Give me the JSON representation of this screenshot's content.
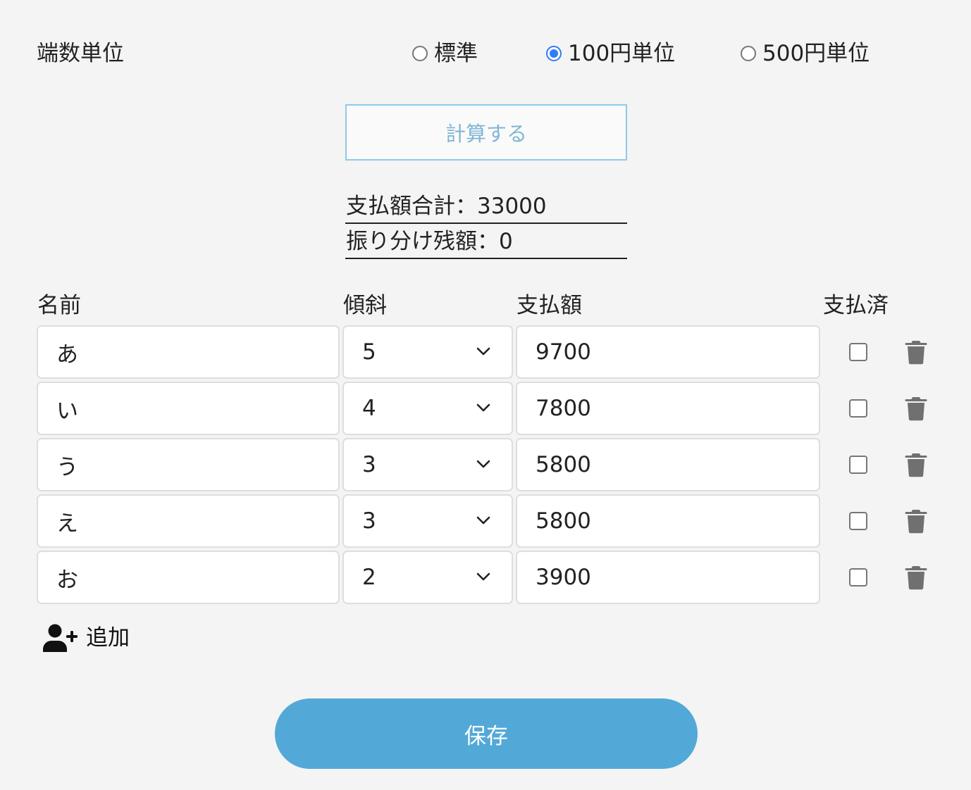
{
  "rounding": {
    "label": "端数単位",
    "options": [
      {
        "label": "標準",
        "checked": false
      },
      {
        "label": "100円単位",
        "checked": true
      },
      {
        "label": "500円単位",
        "checked": false
      }
    ]
  },
  "calc_button_label": "計算する",
  "summary": {
    "total": "支払額合計：33000",
    "remaining": "振り分け残額：0"
  },
  "columns": {
    "name": "名前",
    "slope": "傾斜",
    "amount": "支払額",
    "paid": "支払済"
  },
  "rows": [
    {
      "name": "あ",
      "slope": "5",
      "amount": "9700",
      "paid": false
    },
    {
      "name": "い",
      "slope": "4",
      "amount": "7800",
      "paid": false
    },
    {
      "name": "う",
      "slope": "3",
      "amount": "5800",
      "paid": false
    },
    {
      "name": "え",
      "slope": "3",
      "amount": "5800",
      "paid": false
    },
    {
      "name": "お",
      "slope": "2",
      "amount": "3900",
      "paid": false
    }
  ],
  "add_label": "追加",
  "save_label": "保存",
  "icons": {
    "chevron": "chevron-down-icon",
    "trash": "trash-icon",
    "add_user": "user-plus-icon"
  },
  "colors": {
    "accent": "#2f7cf6",
    "save_button": "#52a9d7",
    "calc_border": "#8ecae6",
    "trash": "#707070"
  }
}
